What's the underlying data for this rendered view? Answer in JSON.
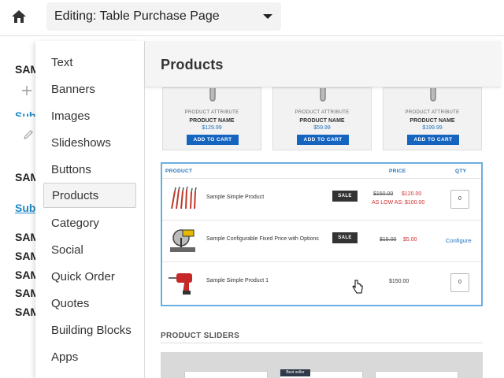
{
  "topbar": {
    "editing_title": "Editing: Table Purchase Page"
  },
  "background": {
    "texts": [
      "SAM",
      "SAM",
      "SAM",
      "SAM",
      "SAM",
      "SAM",
      "SAM"
    ],
    "link_partial_1": "Sub",
    "link_partial_2": "Sub"
  },
  "menu": {
    "items": [
      {
        "label": "Text"
      },
      {
        "label": "Banners"
      },
      {
        "label": "Images"
      },
      {
        "label": "Slideshows"
      },
      {
        "label": "Buttons"
      },
      {
        "label": "Products",
        "active": true
      },
      {
        "label": "Category"
      },
      {
        "label": "Social"
      },
      {
        "label": "Quick Order"
      },
      {
        "label": "Quotes"
      },
      {
        "label": "Building Blocks"
      },
      {
        "label": "Apps"
      }
    ]
  },
  "panel": {
    "title": "Products",
    "cards": [
      {
        "attribute": "PRODUCT ATTRIBUTE",
        "name": "PRODUCT NAME",
        "price": "$129.99",
        "button": "ADD TO CART"
      },
      {
        "attribute": "PRODUCT ATTRIBUTE",
        "name": "PRODUCT NAME",
        "price": "$59.99",
        "button": "ADD TO CART"
      },
      {
        "attribute": "PRODUCT ATTRIBUTE",
        "name": "PRODUCT NAME",
        "price": "$199.99",
        "button": "ADD TO CART"
      }
    ],
    "table": {
      "headers": {
        "product": "PRODUCT",
        "price": "PRICE",
        "qty": "QTY"
      },
      "rows": [
        {
          "name": "Sample Simple Product",
          "sale": "SALE",
          "old_price": "$150.00",
          "new_price": "$120.00",
          "as_low_as": "AS LOW AS: $100.00",
          "qty": "0"
        },
        {
          "name": "Sample Configurable Fixed Price with Options",
          "sale": "SALE",
          "old_price": "$15.00",
          "new_price": "$5.00",
          "action": "Configure"
        },
        {
          "name": "Sample Simple Product 1",
          "price": "$150.00",
          "qty": "0"
        }
      ]
    },
    "sliders_title": "PRODUCT SLIDERS",
    "slider_badge": "Best seller"
  },
  "colors": {
    "accent": "#1565c0",
    "link": "#1e73be",
    "sale_price": "#d32f2f",
    "table_border": "#6aaee0"
  }
}
